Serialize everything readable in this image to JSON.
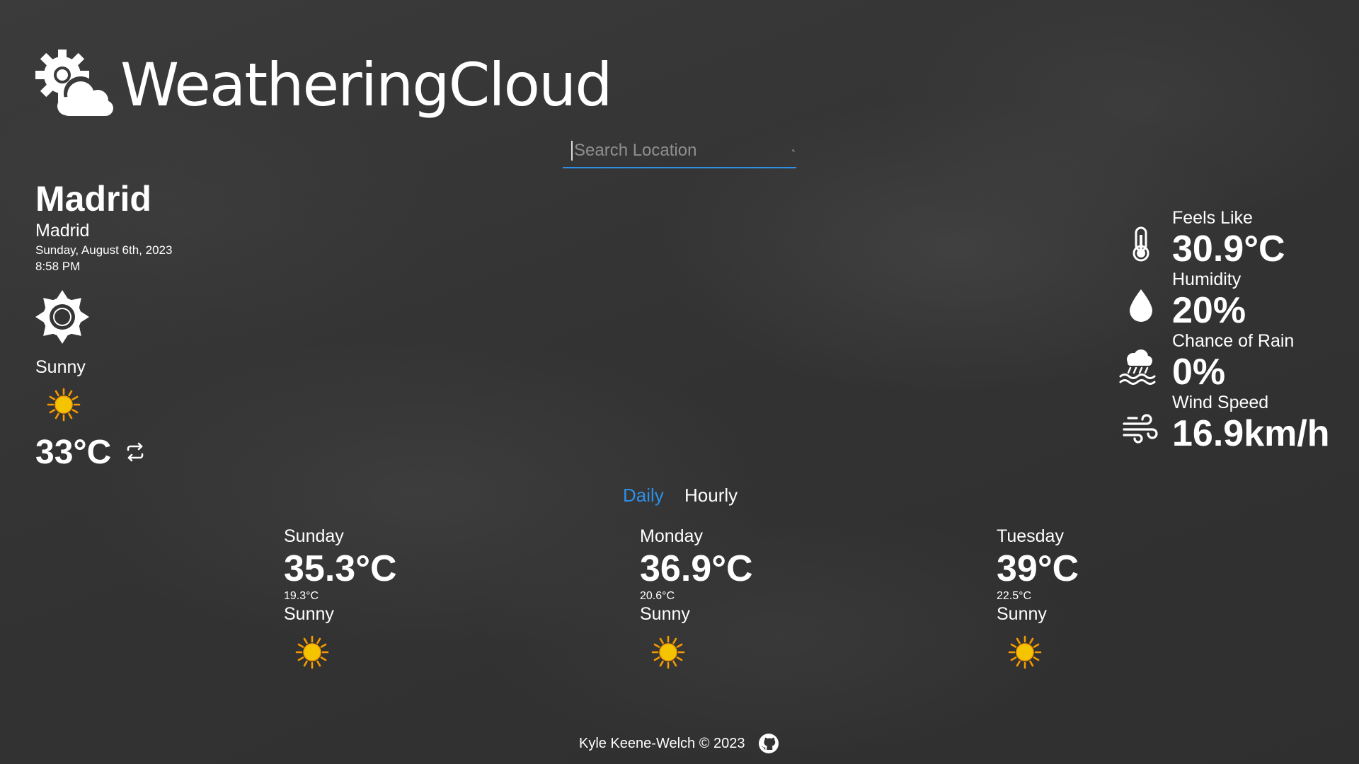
{
  "brand": {
    "name": "WeatheringCloud"
  },
  "search": {
    "placeholder": "Search Location",
    "value": ""
  },
  "current": {
    "city": "Madrid",
    "region": "Madrid",
    "date": "Sunday, August 6th, 2023",
    "time": "8:58 PM",
    "condition": "Sunny",
    "temperature": "33°C"
  },
  "stats": [
    {
      "label": "Feels Like",
      "value": "30.9°C",
      "icon": "thermometer-icon"
    },
    {
      "label": "Humidity",
      "value": "20%",
      "icon": "droplet-icon"
    },
    {
      "label": "Chance of Rain",
      "value": "0%",
      "icon": "rain-cloud-icon"
    },
    {
      "label": "Wind Speed",
      "value": "16.9km/h",
      "icon": "wind-icon"
    }
  ],
  "tabs": {
    "daily": "Daily",
    "hourly": "Hourly",
    "active": "Daily"
  },
  "forecast": [
    {
      "day": "Sunday",
      "high": "35.3°C",
      "low": "19.3°C",
      "condition": "Sunny"
    },
    {
      "day": "Monday",
      "high": "36.9°C",
      "low": "20.6°C",
      "condition": "Sunny"
    },
    {
      "day": "Tuesday",
      "high": "39°C",
      "low": "22.5°C",
      "condition": "Sunny"
    }
  ],
  "footer": {
    "text": "Kyle Keene-Welch © 2023"
  },
  "colors": {
    "accent": "#2d8fe6",
    "sun": "#f5c400",
    "sun_rays": "#f59a00"
  }
}
